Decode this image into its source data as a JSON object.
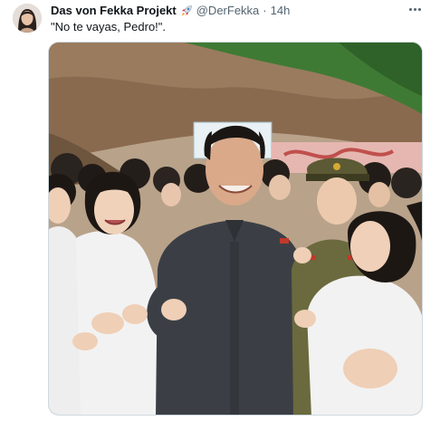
{
  "tweet": {
    "author_name": "Das von Fekka Projekt",
    "handle": "@DerFekka",
    "separator": "·",
    "time": "14h",
    "text": "\"No te vayas, Pedro!\".",
    "more_icon": "more-horizontal-icon",
    "badge_icon": "rocket-emoji-icon"
  },
  "media": {
    "kind": "photo",
    "background_sign_text": "",
    "colors": {
      "hillside": "#8a6a4f",
      "foliage": "#3f7a34",
      "suit": "#3b3f45",
      "white_uniform": "#f2f2f2",
      "military_uniform": "#6b6a3e"
    }
  }
}
